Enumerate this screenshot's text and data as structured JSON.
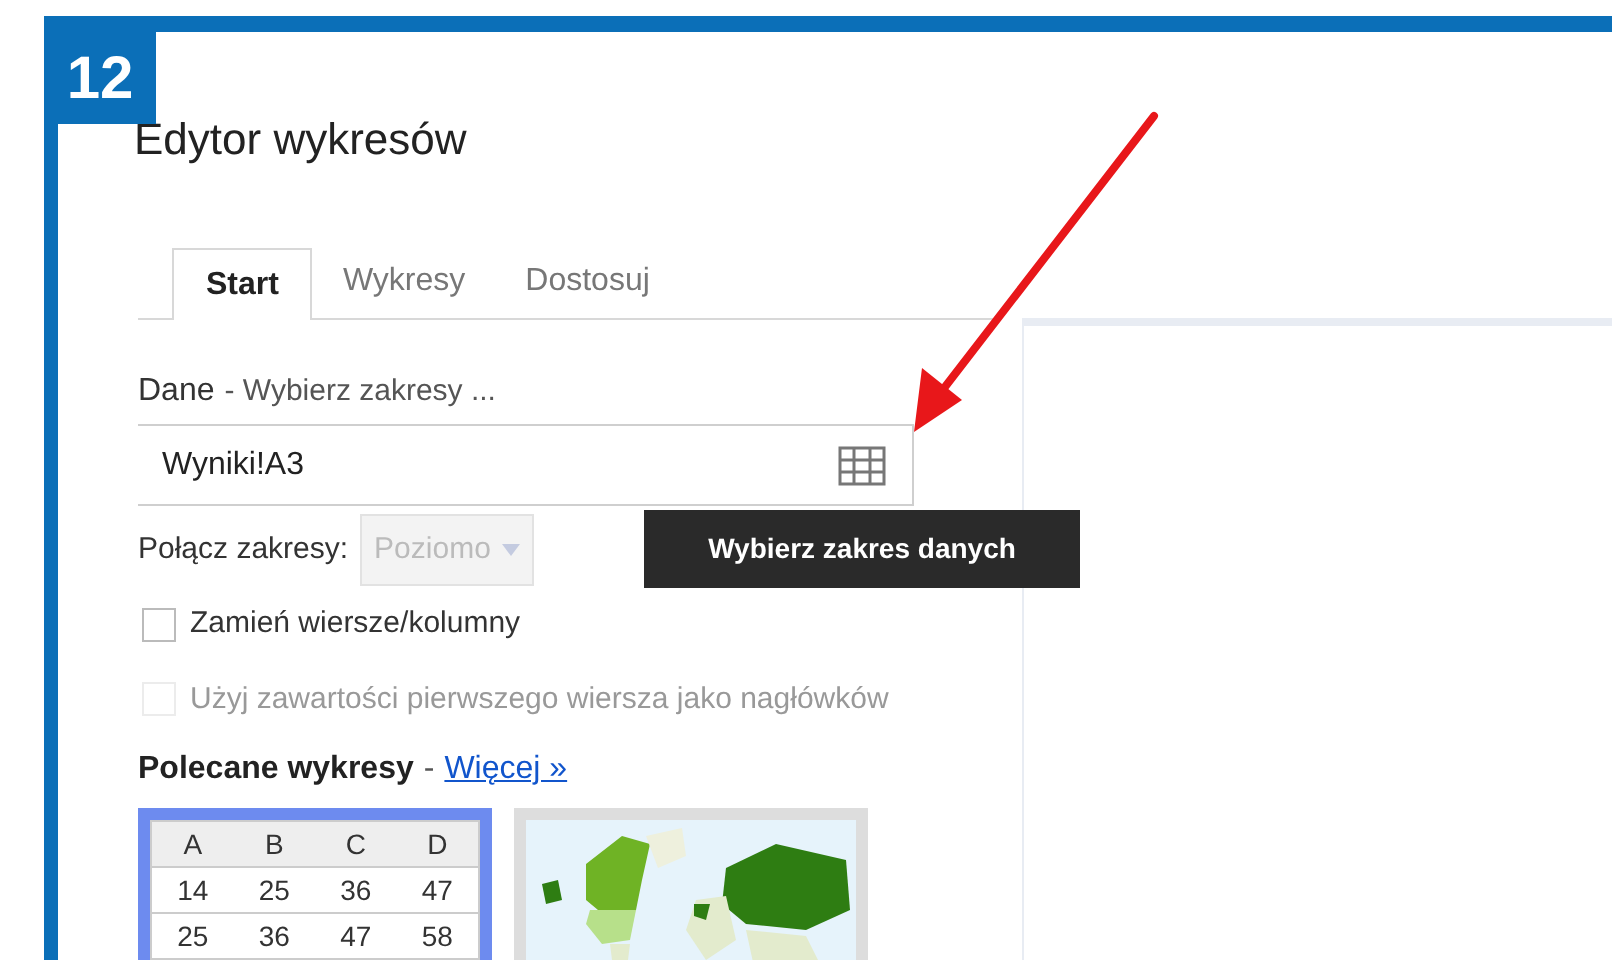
{
  "badge": "12",
  "title": "Edytor wykresów",
  "tabs": [
    {
      "label": "Start",
      "selected": true
    },
    {
      "label": "Wykresy",
      "selected": false
    },
    {
      "label": "Dostosuj",
      "selected": false
    }
  ],
  "data_section": {
    "label": "Dane",
    "hint": "- Wybierz zakresy ...",
    "range_value": "Wyniki!A3",
    "tooltip": "Wybierz zakres danych"
  },
  "combine": {
    "label": "Połącz zakresy:",
    "value": "Poziomo",
    "disabled": true
  },
  "checkboxes": [
    {
      "label": "Zamień wiersze/kolumny",
      "checked": false,
      "disabled": false
    },
    {
      "label": "Użyj zawartości pierwszego wiersza jako nagłówków",
      "checked": false,
      "disabled": true
    }
  ],
  "recommended": {
    "title": "Polecane wykresy",
    "separator": "-",
    "link": "Więcej »",
    "charts": [
      {
        "kind": "table",
        "selected": true,
        "columns": [
          "A",
          "B",
          "C",
          "D"
        ],
        "rows": [
          [
            "14",
            "25",
            "36",
            "47"
          ],
          [
            "25",
            "36",
            "47",
            "58"
          ]
        ]
      },
      {
        "kind": "picture",
        "selected": false
      }
    ]
  }
}
